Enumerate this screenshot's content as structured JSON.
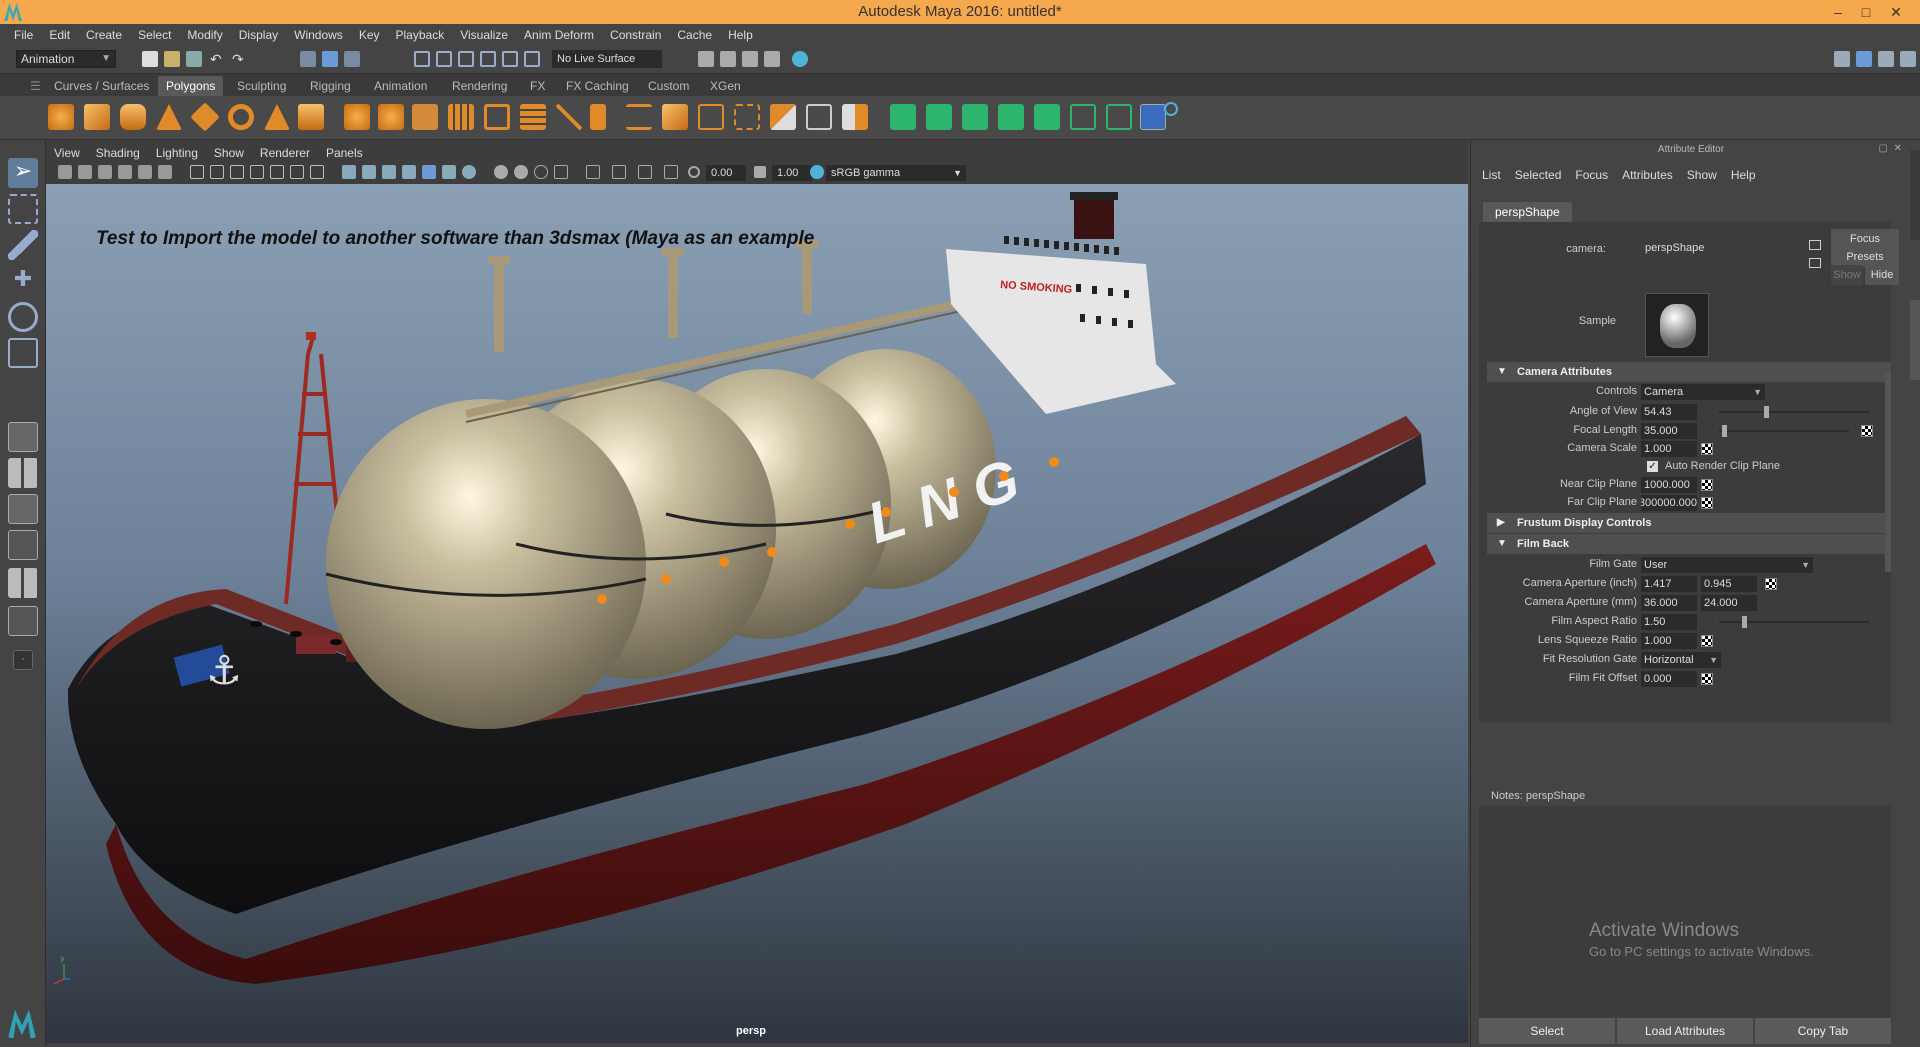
{
  "window": {
    "title": "Autodesk Maya 2016: untitled*"
  },
  "menubar": [
    "File",
    "Edit",
    "Create",
    "Select",
    "Modify",
    "Display",
    "Windows",
    "Key",
    "Playback",
    "Visualize",
    "Anim Deform",
    "Constrain",
    "Cache",
    "Help"
  ],
  "statusline": {
    "mode": "Animation",
    "live_surface": "No Live Surface"
  },
  "shelf_tabs": [
    "Curves / Surfaces",
    "Polygons",
    "Sculpting",
    "Rigging",
    "Animation",
    "Rendering",
    "FX",
    "FX Caching",
    "Custom",
    "XGen"
  ],
  "shelf_active": "Polygons",
  "viewport": {
    "menu": [
      "View",
      "Shading",
      "Lighting",
      "Show",
      "Renderer",
      "Panels"
    ],
    "exposure": "0.00",
    "gamma_value": "1.00",
    "color_space": "sRGB gamma",
    "caption": "Test to Import the model to another software than 3dsmax (Maya as an example",
    "camera_name": "persp",
    "hull_text": "LNG",
    "deck_sign": "NO SMOKING"
  },
  "attribute_editor": {
    "title": "Attribute Editor",
    "menu": [
      "List",
      "Selected",
      "Focus",
      "Attributes",
      "Show",
      "Help"
    ],
    "tab": "perspShape",
    "camera_label": "camera:",
    "camera_value": "perspShape",
    "focus_btn": "Focus",
    "presets_btn": "Presets",
    "show_btn": "Show",
    "hide_btn": "Hide",
    "sample_label": "Sample",
    "sections": {
      "camera_attributes": "Camera Attributes",
      "frustum": "Frustum Display Controls",
      "film_back": "Film Back"
    },
    "fields": {
      "controls_label": "Controls",
      "controls_value": "Camera",
      "aov_label": "Angle of View",
      "aov_value": "54.43",
      "focal_label": "Focal Length",
      "focal_value": "35.000",
      "camscale_label": "Camera Scale",
      "camscale_value": "1.000",
      "auto_clip_label": "Auto Render Clip Plane",
      "near_label": "Near Clip Plane",
      "near_value": "1000.000",
      "far_label": "Far Clip Plane",
      "far_value": "300000.000",
      "filmgate_label": "Film Gate",
      "filmgate_value": "User",
      "ap_inch_label": "Camera Aperture (inch)",
      "ap_inch_1": "1.417",
      "ap_inch_2": "0.945",
      "ap_mm_label": "Camera Aperture (mm)",
      "ap_mm_1": "36.000",
      "ap_mm_2": "24.000",
      "aspect_label": "Film Aspect Ratio",
      "aspect_value": "1.50",
      "squeeze_label": "Lens Squeeze Ratio",
      "squeeze_value": "1.000",
      "fitgate_label": "Fit Resolution Gate",
      "fitgate_value": "Horizontal",
      "fitoffset_label": "Film Fit Offset",
      "fitoffset_value": "0.000"
    },
    "slider_levels": {
      "aov": 0.3,
      "focal": 0.02,
      "aspect": 0.15
    },
    "notes_label": "Notes:  perspShape",
    "activate_title": "Activate Windows",
    "activate_sub": "Go to PC settings to activate Windows.",
    "buttons": {
      "select": "Select",
      "load": "Load Attributes",
      "copy": "Copy Tab"
    }
  }
}
